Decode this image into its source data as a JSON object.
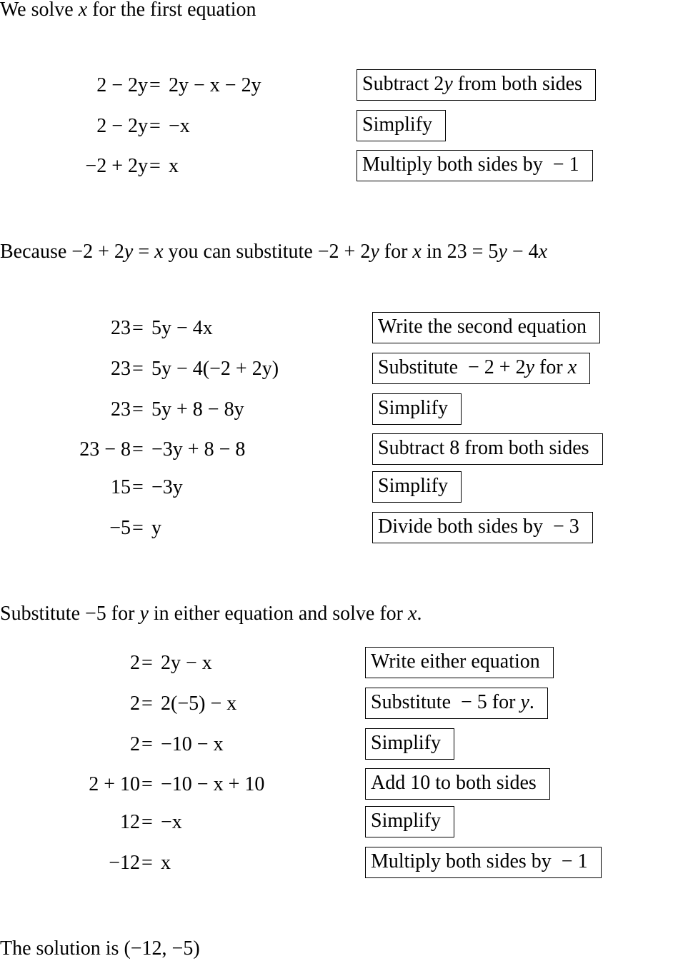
{
  "sections": [
    {
      "intro": "We solve x for the first equation",
      "rows": [
        {
          "lhs": "2 − 2y",
          "rhs": "2y − x − 2y",
          "step": "Subtract 2y from both sides"
        },
        {
          "lhs": "2 − 2y",
          "rhs": "−x",
          "step": "Simplify"
        },
        {
          "lhs": "−2 + 2y",
          "rhs": "x",
          "step": "Multiply both sides by  − 1"
        }
      ]
    },
    {
      "intro": "Because −2 + 2y = x you can substitute −2 + 2y for x in 23 = 5y − 4x",
      "rows": [
        {
          "lhs": "23",
          "rhs": "5y − 4x",
          "step": "Write the second equation"
        },
        {
          "lhs": "23",
          "rhs": "5y − 4(−2 + 2y)",
          "step": "Substitute  − 2 + 2y for x"
        },
        {
          "lhs": "23",
          "rhs": "5y + 8 − 8y",
          "step": "Simplify"
        },
        {
          "lhs": "23 − 8",
          "rhs": "−3y + 8 − 8",
          "step": "Subtract 8 from both sides"
        },
        {
          "lhs": "15",
          "rhs": "−3y",
          "step": "Simplify"
        },
        {
          "lhs": "−5",
          "rhs": "y",
          "step": "Divide both sides by  − 3"
        }
      ]
    },
    {
      "intro": "Substitute −5 for y in either equation and solve for x.",
      "rows": [
        {
          "lhs": "2",
          "rhs": "2y − x",
          "step": "Write either equation"
        },
        {
          "lhs": "2",
          "rhs": "2(−5) − x",
          "step": "Substitute  − 5 for y."
        },
        {
          "lhs": "2",
          "rhs": "−10 − x",
          "step": "Simplify"
        },
        {
          "lhs": "2 + 10",
          "rhs": "−10 − x + 10",
          "step": "Add 10 to both sides"
        },
        {
          "lhs": "12",
          "rhs": "−x",
          "step": "Simplify"
        },
        {
          "lhs": "−12",
          "rhs": "x",
          "step": "Multiply both sides by  − 1"
        }
      ]
    }
  ],
  "equals": "=",
  "conclusion": "The solution is (−12, −5)"
}
